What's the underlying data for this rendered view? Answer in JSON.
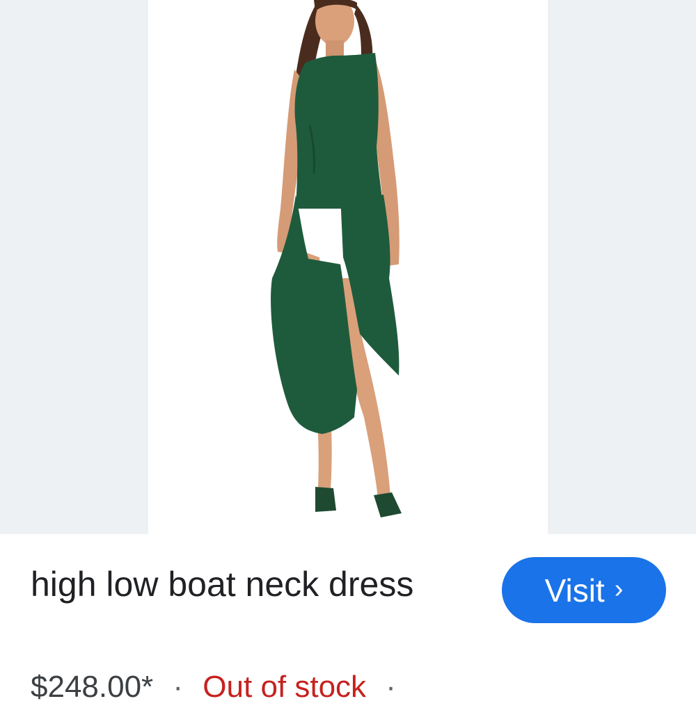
{
  "product": {
    "image_alt": "Woman in green high low boat neck dress",
    "title": "high low boat neck dress",
    "price": "$248.00*",
    "separator": "·",
    "stock_status": "Out of stock",
    "trailing_separator": "·"
  },
  "actions": {
    "visit_label": "Visit",
    "visit_icon": "chevron-right-icon"
  },
  "colors": {
    "accent": "#1a73e8",
    "out_of_stock": "#c5221f",
    "dress": "#1e5b3c",
    "page_background": "#edf1f3"
  }
}
